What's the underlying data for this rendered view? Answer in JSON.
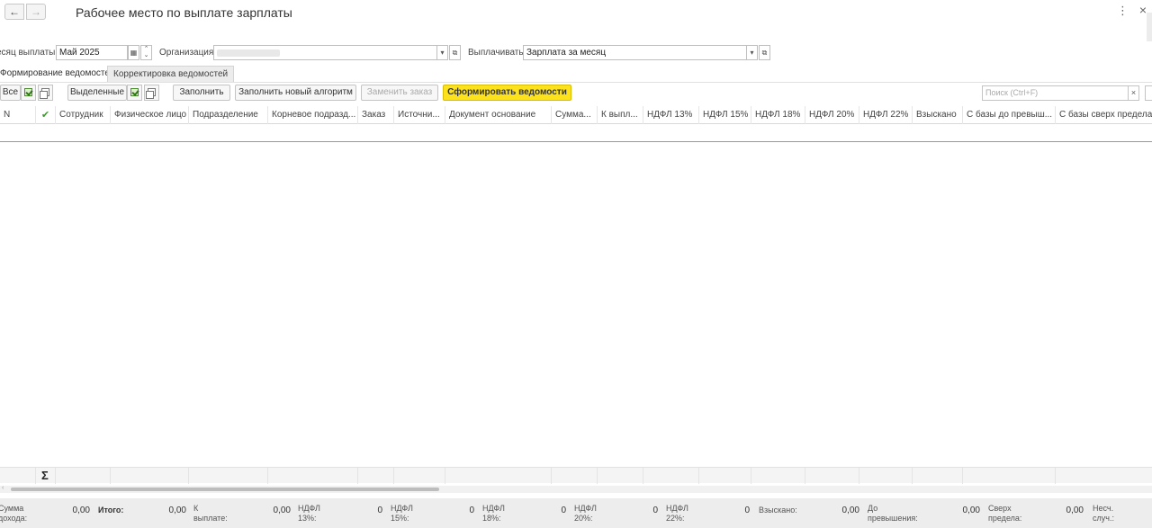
{
  "window": {
    "title": "Рабочее место по выплате зарплаты",
    "back_glyph": "←",
    "forward_glyph": "→",
    "menu_glyph": "⋮",
    "close_glyph": "×"
  },
  "filters": {
    "month_label": "есяц выплаты:",
    "month_value": "Май 2025",
    "org_label": "Организация:",
    "pay_label": "Выплачивать:",
    "pay_value": "Зарплата за месяц",
    "dropdown_glyph": "▾",
    "open_glyph": "⧉"
  },
  "tabs": [
    {
      "label": "Формирование ведомостей",
      "active": true
    },
    {
      "label": "Корректировка ведомостей",
      "active": false
    }
  ],
  "toolbar": {
    "all_label": "Все",
    "selected_label": "Выделенные",
    "fill_label": "Заполнить",
    "fill_new_label": "Заполнить новый алгоритм",
    "replace_order_label": "Заменить заказ",
    "generate_label": "Сформировать ведомости",
    "search_placeholder": "Поиск (Ctrl+F)",
    "clear_glyph": "×"
  },
  "table": {
    "columns": [
      "N",
      "✔",
      "Сотрудник",
      "Физическое лицо",
      "Подразделение",
      "Корневое подразд...",
      "Заказ",
      "Источни...",
      "Документ основание",
      "Сумма...",
      "К выпл...",
      "НДФЛ 13%",
      "НДФЛ 15%",
      "НДФЛ 18%",
      "НДФЛ 20%",
      "НДФЛ 22%",
      "Взыскано",
      "С базы до превыш...",
      "С базы сверх предела"
    ],
    "sum_glyph": "Σ"
  },
  "totals": [
    {
      "label1": "Сумма",
      "label2": "дохода:",
      "value": "0,00"
    },
    {
      "label1": "Итого:",
      "label2": "",
      "value": "0,00"
    },
    {
      "label1": "К",
      "label2": "выплате:",
      "value": "0,00"
    },
    {
      "label1": "НДФЛ",
      "label2": "13%:",
      "value": "0"
    },
    {
      "label1": "НДФЛ",
      "label2": "15%:",
      "value": "0"
    },
    {
      "label1": "НДФЛ",
      "label2": "18%:",
      "value": "0"
    },
    {
      "label1": "НДФЛ",
      "label2": "20%:",
      "value": "0"
    },
    {
      "label1": "НДФЛ",
      "label2": "22%:",
      "value": "0"
    },
    {
      "label1": "Взыскано:",
      "label2": "",
      "value": "0,00"
    },
    {
      "label1": "До",
      "label2": "превышения:",
      "value": "0,00"
    },
    {
      "label1": "Сверх",
      "label2": "предела:",
      "value": "0,00"
    },
    {
      "label1": "Несч.",
      "label2": "случ.:",
      "value": ""
    }
  ],
  "colors": {
    "accent_button": "#fbe21d",
    "check_green": "#3c9a2c"
  }
}
